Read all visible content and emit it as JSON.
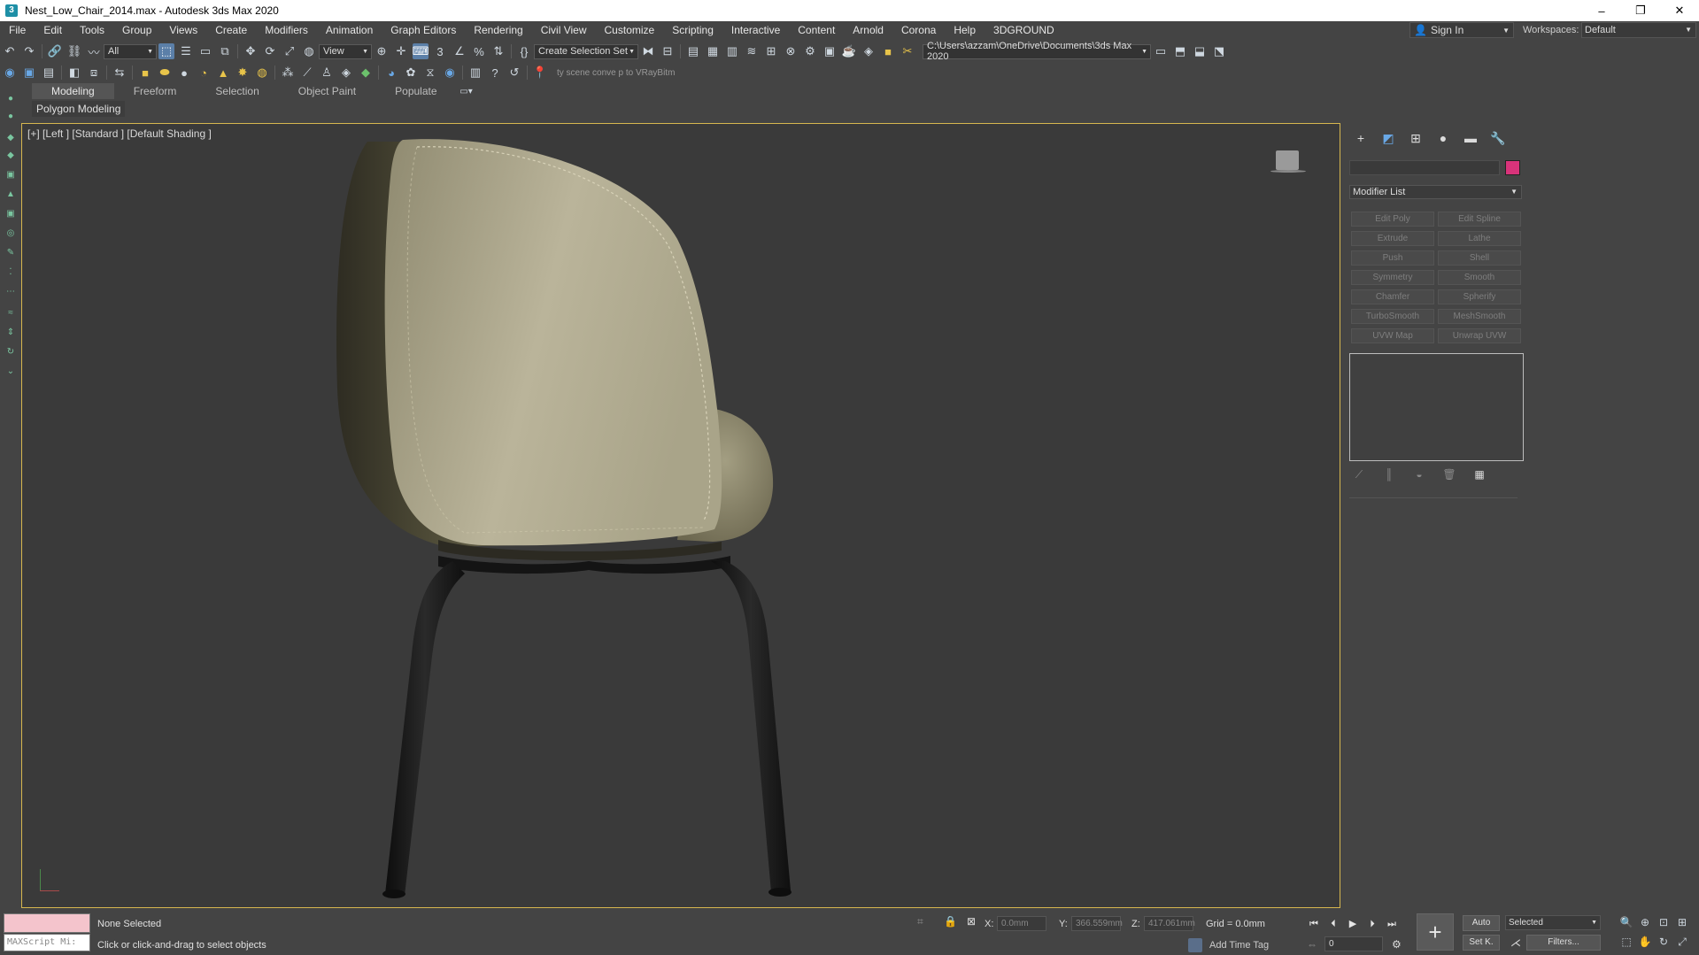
{
  "window": {
    "title": "Nest_Low_Chair_2014.max - Autodesk 3ds Max 2020",
    "minimize": "–",
    "restore": "❐",
    "close": "✕"
  },
  "menu": {
    "items": [
      "File",
      "Edit",
      "Tools",
      "Group",
      "Views",
      "Create",
      "Modifiers",
      "Animation",
      "Graph Editors",
      "Rendering",
      "Civil View",
      "Customize",
      "Scripting",
      "Interactive",
      "Content",
      "Arnold",
      "Corona",
      "Help",
      "3DGROUND"
    ],
    "sign_in": "Sign In",
    "workspaces_label": "Workspaces:",
    "workspace_value": "Default"
  },
  "main_toolbar": {
    "selection_filter": "All",
    "ref_coord": "View",
    "named_selection": "Create Selection Set",
    "project_path": "C:\\Users\\azzam\\OneDrive\\Documents\\3ds Max 2020",
    "scene_converter_hint": "ty scene conve p to VRayBitm"
  },
  "ribbon": {
    "tabs": [
      "Modeling",
      "Freeform",
      "Selection",
      "Object Paint",
      "Populate"
    ],
    "subpanel": "Polygon Modeling"
  },
  "viewport": {
    "label": "[+] [Left ] [Standard ] [Default Shading ]"
  },
  "command_panel": {
    "modifier_list": "Modifier List",
    "modifier_buttons": [
      "Edit Poly",
      "Edit Spline",
      "Extrude",
      "Lathe",
      "Push",
      "Shell",
      "Symmetry",
      "Smooth",
      "Chamfer",
      "Spherify",
      "TurboSmooth",
      "MeshSmooth",
      "UVW Map",
      "Unwrap UVW"
    ],
    "object_color": "#d8337a"
  },
  "status": {
    "maxscript_placeholder": "MAXScript Mi:",
    "selection_status": "None Selected",
    "prompt": "Click or click-and-drag to select objects",
    "x_label": "X:",
    "x_value": "0.0mm",
    "y_label": "Y:",
    "y_value": "366.559mm",
    "z_label": "Z:",
    "z_value": "417.061mm",
    "grid": "Grid = 0.0mm",
    "add_time_tag": "Add Time Tag",
    "frame": "0",
    "auto": "Auto",
    "set_key": "Set K.",
    "key_filter": "Selected",
    "filters": "Filters..."
  },
  "colors": {
    "viewport_border": "#d6b64f",
    "upholstery": "#b3ad8c",
    "legs": "#1a1a1a"
  }
}
